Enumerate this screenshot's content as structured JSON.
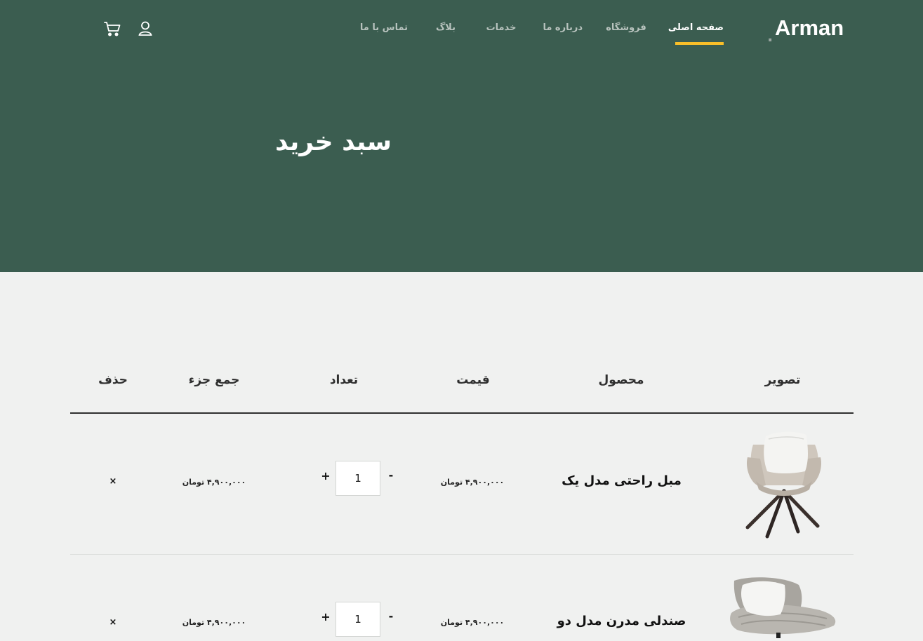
{
  "brand": {
    "name": "Arman",
    "dot": "."
  },
  "nav": {
    "items": [
      {
        "label": "صفحه اصلی",
        "active": true
      },
      {
        "label": "فروشگاه"
      },
      {
        "label": "درباره ما"
      },
      {
        "label": "خدمات"
      },
      {
        "label": "بلاگ"
      },
      {
        "label": "تماس با ما"
      }
    ],
    "icons": [
      "user-icon",
      "cart-icon"
    ]
  },
  "hero": {
    "title": "سبد خرید"
  },
  "cart": {
    "columns": {
      "image": "تصویر",
      "product": "محصول",
      "price": "قیمت",
      "quantity": "تعداد",
      "subtotal": "جمع جزء",
      "remove": "حذف"
    },
    "items": [
      {
        "name": "مبل راحتی مدل یک",
        "price": "۴,۹۰۰,۰۰۰ تومان",
        "quantity": "1",
        "subtotal": "۴,۹۰۰,۰۰۰ تومان",
        "minus": "-",
        "plus": "+",
        "remove": "×"
      },
      {
        "name": "صندلی مدرن مدل دو",
        "price": "۴,۹۰۰,۰۰۰ تومان",
        "quantity": "1",
        "subtotal": "۴,۹۰۰,۰۰۰ تومان",
        "minus": "-",
        "plus": "+",
        "remove": "×"
      }
    ]
  },
  "colors": {
    "hero_bg": "#3b5d50",
    "accent": "#f9bf29",
    "page_bg": "#f0f1f0"
  }
}
